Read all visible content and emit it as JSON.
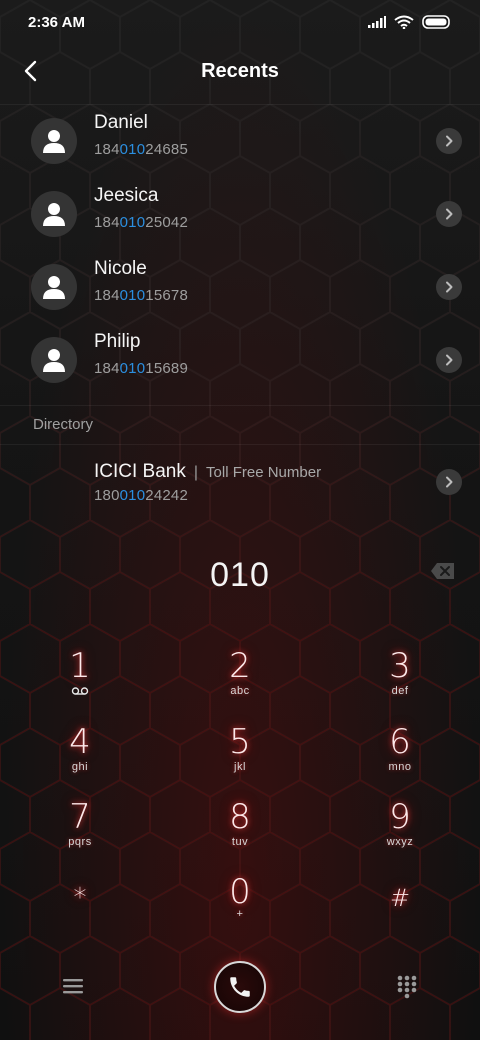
{
  "status_bar": {
    "time": "2:36 AM"
  },
  "header": {
    "title": "Recents"
  },
  "recents": [
    {
      "name": "Daniel",
      "number_prefix": "184",
      "number_match": "010",
      "number_suffix": "24685"
    },
    {
      "name": "Jeesica",
      "number_prefix": "184",
      "number_match": "010",
      "number_suffix": "25042"
    },
    {
      "name": "Nicole",
      "number_prefix": "184",
      "number_match": "010",
      "number_suffix": "15678"
    },
    {
      "name": "Philip",
      "number_prefix": "184",
      "number_match": "010",
      "number_suffix": "15689"
    }
  ],
  "directory": {
    "label": "Directory",
    "entry": {
      "name": "ICICI Bank",
      "separator": "|",
      "subtitle": "Toll Free Number",
      "number_prefix": "180",
      "number_match": "010",
      "number_suffix": "24242"
    }
  },
  "dialer": {
    "input": "010",
    "keys": [
      {
        "digit": "1",
        "letters": ""
      },
      {
        "digit": "2",
        "letters": "abc"
      },
      {
        "digit": "3",
        "letters": "def"
      },
      {
        "digit": "4",
        "letters": "ghi"
      },
      {
        "digit": "5",
        "letters": "jkl"
      },
      {
        "digit": "6",
        "letters": "mno"
      },
      {
        "digit": "7",
        "letters": "pqrs"
      },
      {
        "digit": "8",
        "letters": "tuv"
      },
      {
        "digit": "9",
        "letters": "wxyz"
      },
      {
        "digit": "*",
        "letters": ""
      },
      {
        "digit": "0",
        "letters": "+"
      },
      {
        "digit": "#",
        "letters": ""
      }
    ]
  },
  "colors": {
    "highlight": "#2b8fe0",
    "glow": "#ff3c3c"
  },
  "icons": {
    "back": "back-arrow-icon",
    "avatar": "person-icon",
    "chevron": "chevron-right-icon",
    "backspace": "backspace-icon",
    "voicemail": "voicemail-icon",
    "menu": "menu-icon",
    "call": "phone-icon",
    "dialpad": "dialpad-icon"
  }
}
